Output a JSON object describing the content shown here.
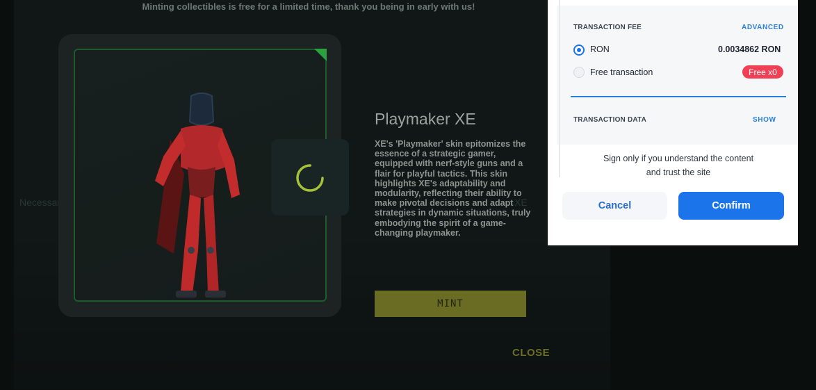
{
  "banner": "Minting collectibles is free for a limited time, thank you being in early with us!",
  "background": {
    "ghost_left": "Necessary Move / Idle",
    "ghost_right": "XE"
  },
  "item": {
    "title": "Playmaker XE",
    "description": "XE's 'Playmaker' skin epitomizes the essence of a strategic gamer, equipped with nerf-style guns and a flair for playful tactics. This skin highlights XE's adaptability and modularity, reflecting their ability to make pivotal decisions and adapt strategies in dynamic situations, truly embodying the spirit of a game-changing playmaker.",
    "mint_label": "MINT",
    "close_label": "CLOSE",
    "loading_icon": "spinner-icon"
  },
  "wallet": {
    "fee_label": "TRANSACTION FEE",
    "advanced_label": "ADVANCED",
    "options": [
      {
        "label": "RON",
        "value": "0.0034862 RON",
        "selected": true
      },
      {
        "label": "Free transaction",
        "badge": "Free x0",
        "selected": false
      }
    ],
    "data_label": "TRANSACTION DATA",
    "show_label": "SHOW",
    "sign_note_line1": "Sign only if you understand the content",
    "sign_note_line2": "and trust the site",
    "cancel_label": "Cancel",
    "confirm_label": "Confirm"
  },
  "colors": {
    "accent_green": "#2ba13f",
    "mint_button": "#6a6c23",
    "wallet_blue": "#1b74ea",
    "badge_red": "#ef4055"
  }
}
